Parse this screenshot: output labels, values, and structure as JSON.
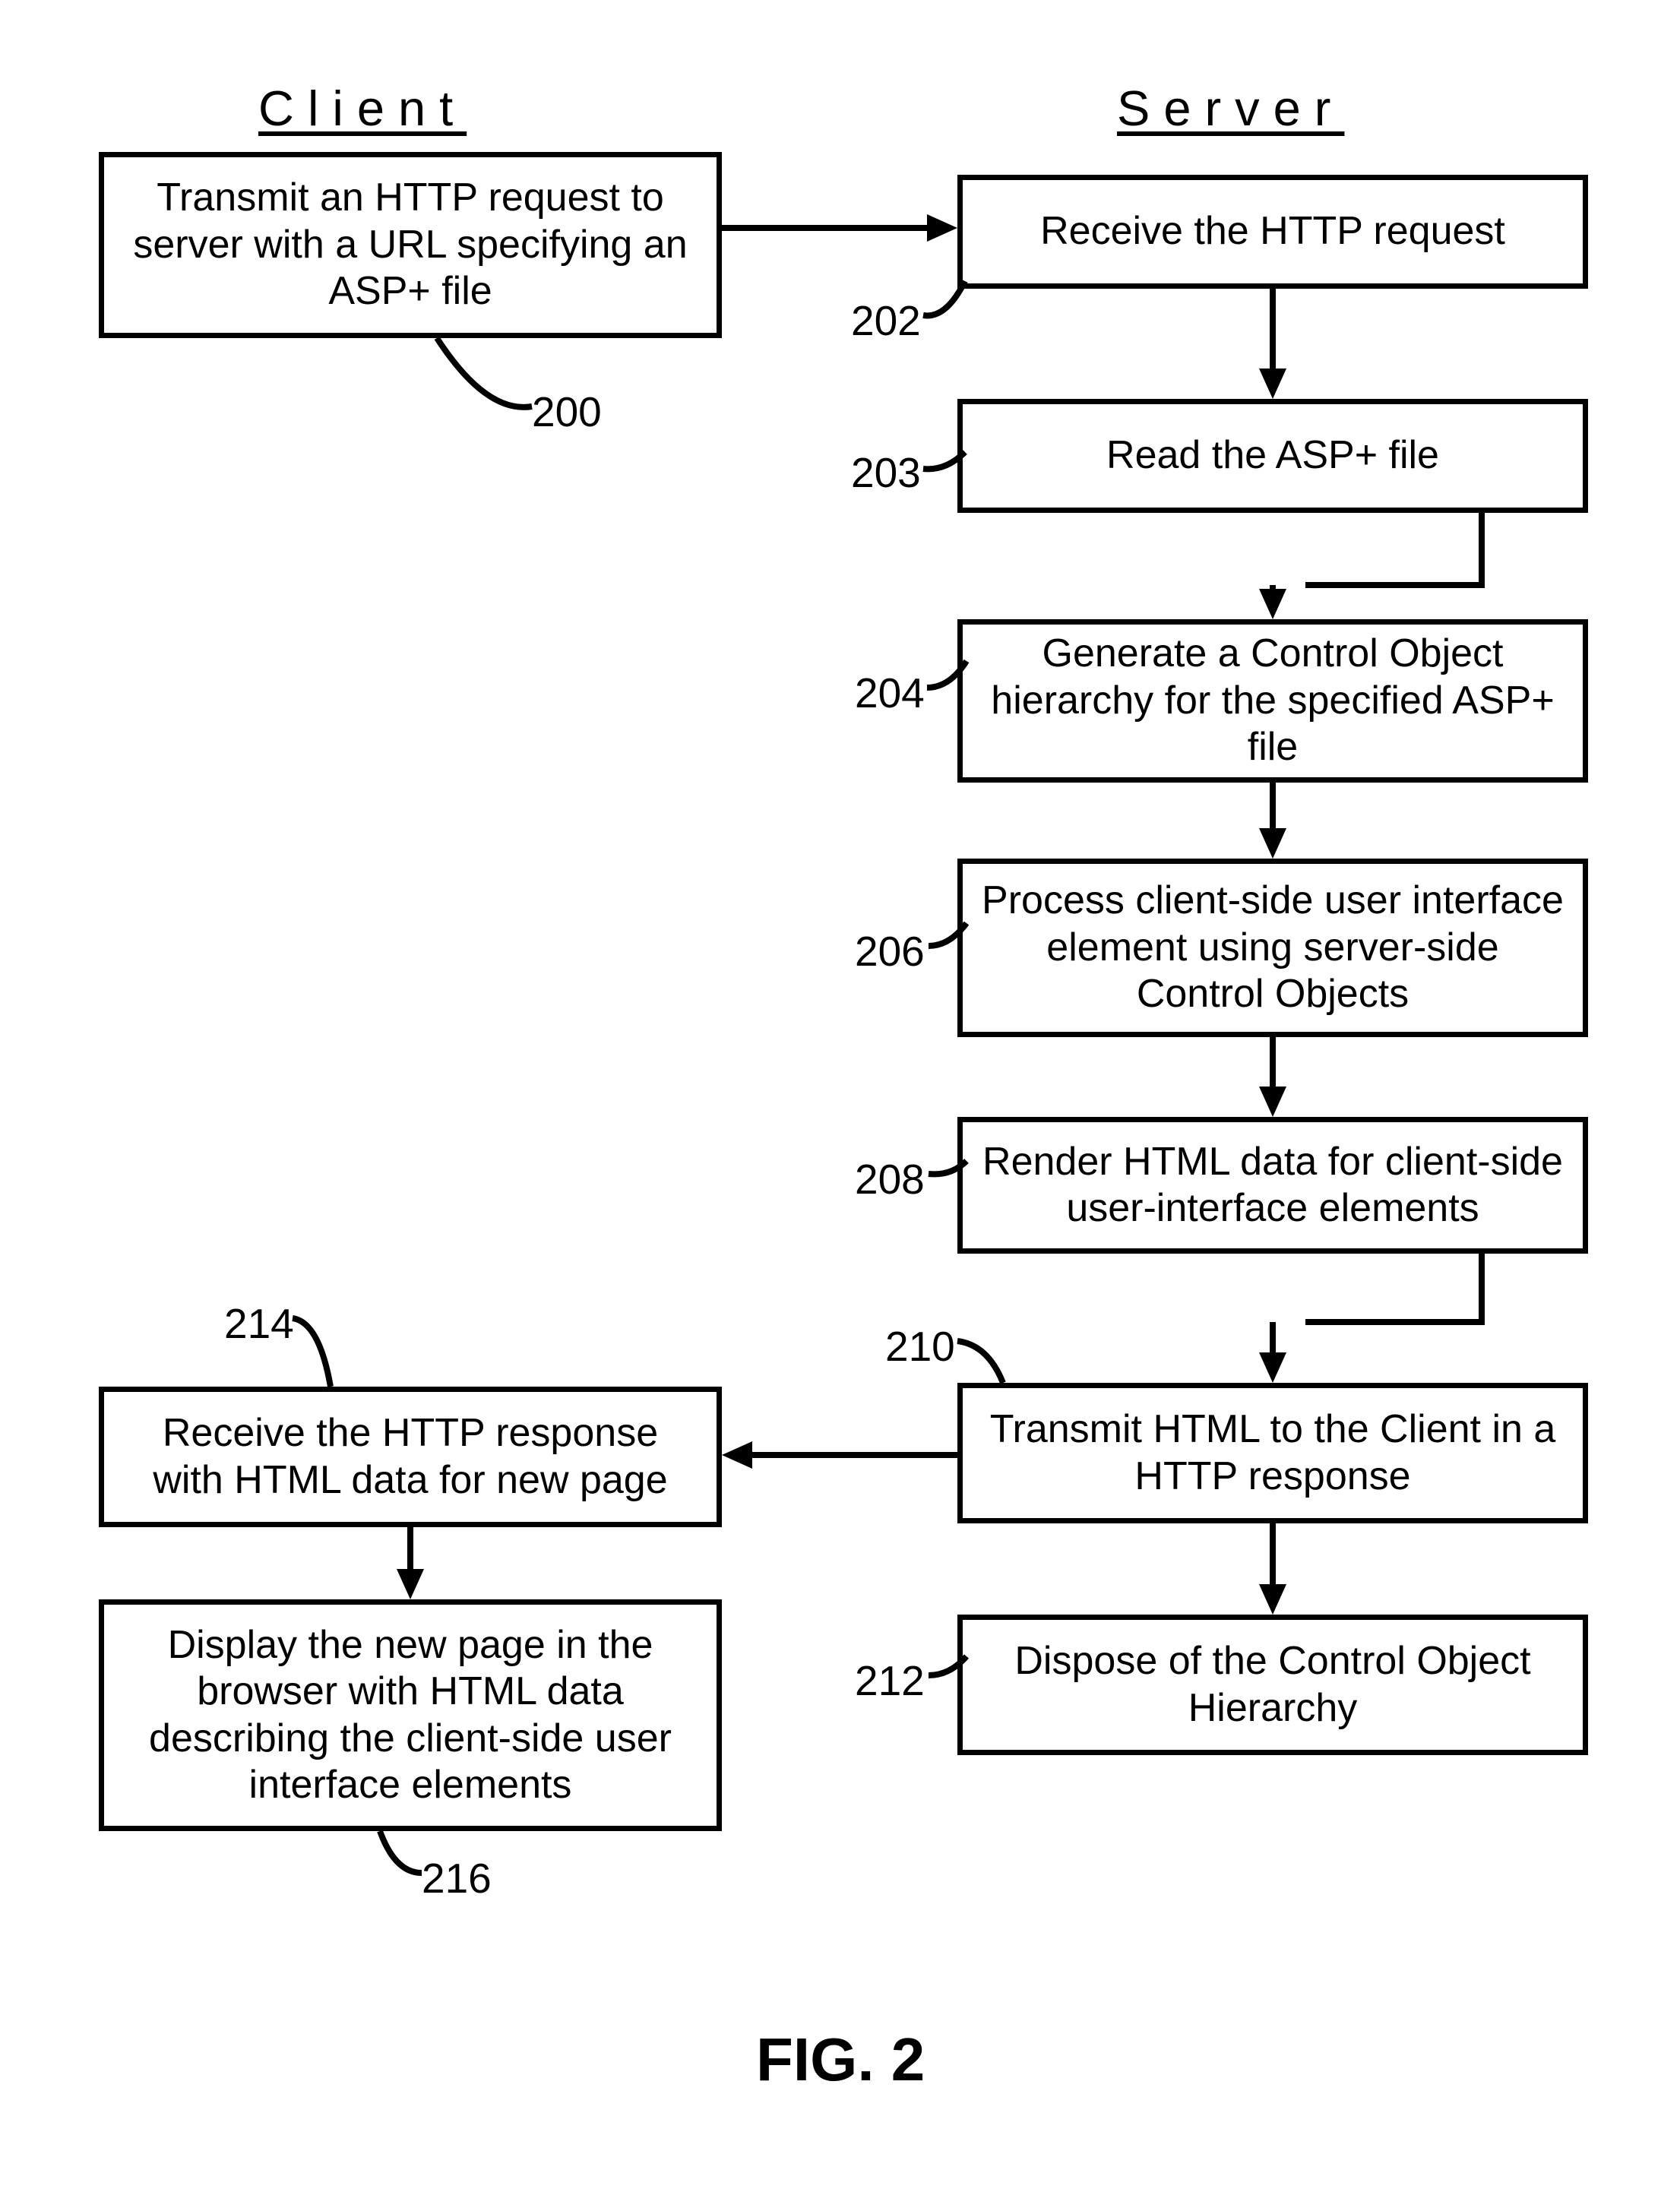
{
  "headings": {
    "client": "Client",
    "server": "Server"
  },
  "boxes": {
    "b200": "Transmit an HTTP request to server with a URL specifying an ASP+ file",
    "b202": "Receive the HTTP request",
    "b203": "Read the ASP+ file",
    "b204": "Generate a Control Object hierarchy for the specified ASP+ file",
    "b206": "Process client-side user interface element using server-side Control Objects",
    "b208": "Render HTML data for client-side user-interface elements",
    "b210": "Transmit HTML to the Client in a HTTP response",
    "b212": "Dispose of the Control Object Hierarchy",
    "b214": "Receive the HTTP response with HTML data for new page",
    "b216": "Display the new page in the browser with HTML data describing the client-side user interface elements"
  },
  "labels": {
    "l200": "200",
    "l202": "202",
    "l203": "203",
    "l204": "204",
    "l206": "206",
    "l208": "208",
    "l210": "210",
    "l212": "212",
    "l214": "214",
    "l216": "216"
  },
  "caption": "FIG. 2"
}
